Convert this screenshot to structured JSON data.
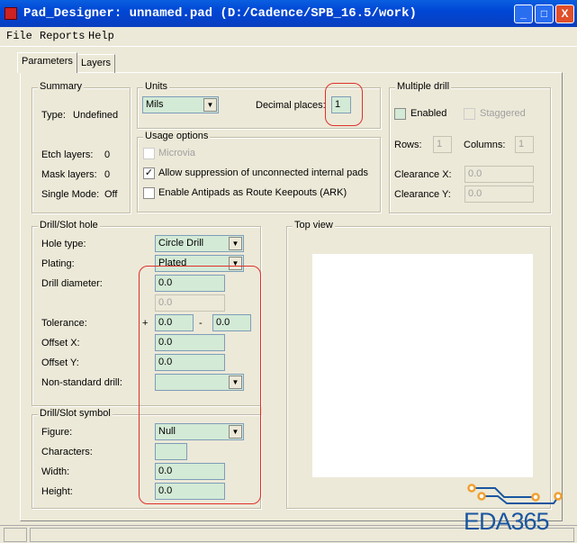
{
  "window": {
    "title": "Pad_Designer: unnamed.pad (D:/Cadence/SPB_16.5/work)",
    "min": "_",
    "max": "□",
    "close": "X"
  },
  "menu": [
    "File",
    "Reports",
    "Help"
  ],
  "tabs": [
    "Parameters",
    "Layers"
  ],
  "summary": {
    "title": "Summary",
    "type_label": "Type:",
    "type_value": "Undefined",
    "etch_label": "Etch layers:",
    "etch_value": "0",
    "mask_label": "Mask layers:",
    "mask_value": "0",
    "single_label": "Single Mode:",
    "single_value": "Off"
  },
  "units": {
    "title": "Units",
    "value": "Mils",
    "decimal_label": "Decimal places:",
    "decimal_value": "1"
  },
  "usage": {
    "title": "Usage options",
    "microvia": "Microvia",
    "allow": "Allow suppression of unconnected internal pads",
    "antipads": "Enable Antipads as Route Keepouts (ARK)"
  },
  "multi": {
    "title": "Multiple drill",
    "enabled": "Enabled",
    "staggered": "Staggered",
    "rows_label": "Rows:",
    "rows": "1",
    "cols_label": "Columns:",
    "cols": "1",
    "clx_label": "Clearance X:",
    "clx": "0.0",
    "cly_label": "Clearance Y:",
    "cly": "0.0"
  },
  "drill": {
    "title": "Drill/Slot hole",
    "hole_label": "Hole type:",
    "hole": "Circle Drill",
    "plating_label": "Plating:",
    "plating": "Plated",
    "diam_label": "Drill diameter:",
    "diam": "0.0",
    "diam2": "0.0",
    "tol_label": "Tolerance:",
    "plus": "+",
    "tol_plus": "0.0",
    "minus": "-",
    "tol_minus": "0.0",
    "ox_label": "Offset X:",
    "ox": "0.0",
    "oy_label": "Offset Y:",
    "oy": "0.0",
    "ns_label": "Non-standard drill:",
    "ns": ""
  },
  "symbol": {
    "title": "Drill/Slot symbol",
    "fig_label": "Figure:",
    "fig": "Null",
    "chars_label": "Characters:",
    "chars": "",
    "w_label": "Width:",
    "w": "0.0",
    "h_label": "Height:",
    "h": "0.0"
  },
  "topview": {
    "title": "Top view"
  },
  "watermark": "EDA365"
}
